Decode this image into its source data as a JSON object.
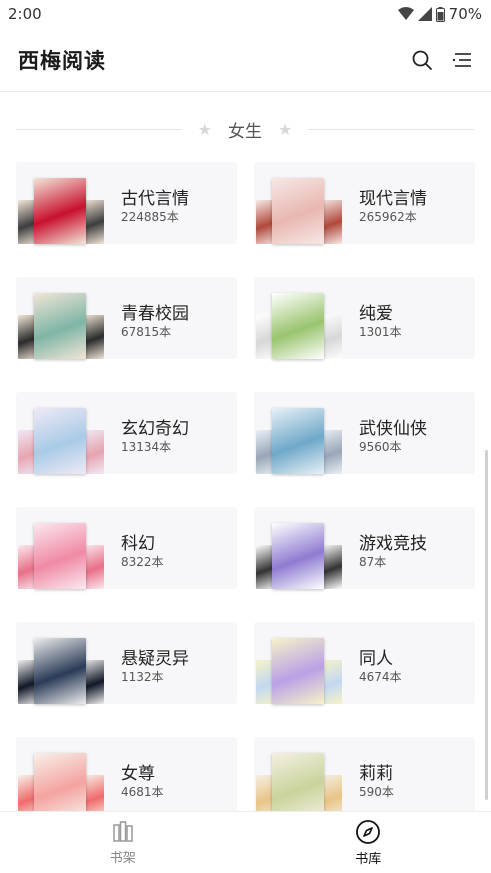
{
  "status": {
    "time": "2:00",
    "battery": "70%"
  },
  "header": {
    "title": "西梅阅读",
    "icons": [
      "search-icon",
      "filter-menu-icon"
    ]
  },
  "section": {
    "title": "女生",
    "decoration_icon": "star-icon"
  },
  "categories": [
    {
      "name": "古代言情",
      "count": "224885本",
      "colors": [
        "#c8102e",
        "#f3e6d8",
        "#3d3d3d"
      ]
    },
    {
      "name": "现代言情",
      "count": "265962本",
      "colors": [
        "#e8b7b0",
        "#f7e8e6",
        "#b0493c"
      ]
    },
    {
      "name": "青春校园",
      "count": "67815本",
      "colors": [
        "#7fb5a6",
        "#f1e6d6",
        "#2b2b2b"
      ]
    },
    {
      "name": "纯爱",
      "count": "1301本",
      "colors": [
        "#9ac46e",
        "#ffffff",
        "#d7d7d7"
      ]
    },
    {
      "name": "玄幻奇幻",
      "count": "13134本",
      "colors": [
        "#a8cbe6",
        "#f0e9f6",
        "#e7a4b0"
      ]
    },
    {
      "name": "武侠仙侠",
      "count": "9560本",
      "colors": [
        "#6fa8c9",
        "#e8f1f6",
        "#9aa6b8"
      ]
    },
    {
      "name": "科幻",
      "count": "8322本",
      "colors": [
        "#f08aa5",
        "#fbe9ef",
        "#e96f88"
      ]
    },
    {
      "name": "游戏竞技",
      "count": "87本",
      "colors": [
        "#8f7bd1",
        "#ffffff",
        "#333333"
      ]
    },
    {
      "name": "悬疑灵异",
      "count": "1132本",
      "colors": [
        "#2a3b57",
        "#eeeeee",
        "#111827"
      ]
    },
    {
      "name": "同人",
      "count": "4674本",
      "colors": [
        "#b9a0e6",
        "#f7f3c9",
        "#c3d8f1"
      ]
    },
    {
      "name": "女尊",
      "count": "4681本",
      "colors": [
        "#f4a3a0",
        "#f7f1ea",
        "#f06b6b"
      ]
    },
    {
      "name": "莉莉",
      "count": "590本",
      "colors": [
        "#c9d39b",
        "#f5f0e3",
        "#e8c487"
      ]
    }
  ],
  "bottom_nav": [
    {
      "label": "书架",
      "icon": "bookshelf-icon",
      "active": false
    },
    {
      "label": "书库",
      "icon": "compass-icon",
      "active": true
    }
  ]
}
